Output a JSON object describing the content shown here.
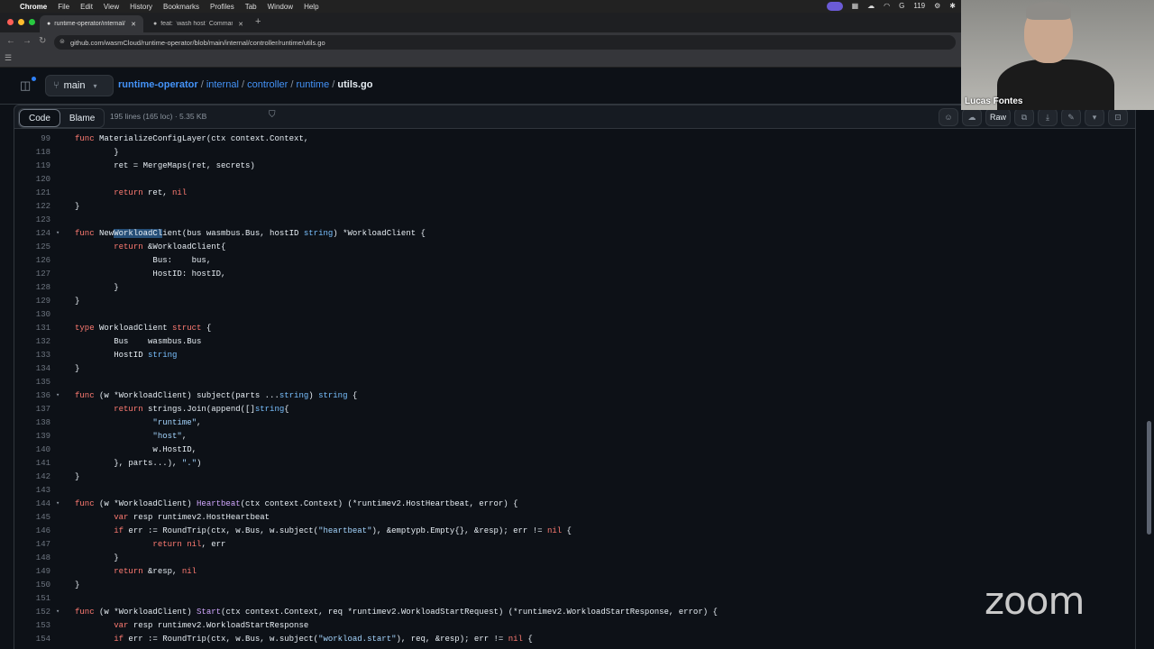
{
  "menubar": {
    "items": [
      "Chrome",
      "File",
      "Edit",
      "View",
      "History",
      "Bookmarks",
      "Profiles",
      "Tab",
      "Window",
      "Help"
    ],
    "status_count": "119"
  },
  "browser": {
    "tabs": [
      {
        "title": "runtime-operator/internal/co"
      },
      {
        "title": "feat: `wash host` Command"
      }
    ],
    "url": "github.com/wasmCloud/runtime-operator/blob/main/internal/controller/runtime/utils.go"
  },
  "repo": {
    "branch": "main",
    "breadcrumb": [
      "runtime-operator",
      "internal",
      "controller",
      "runtime"
    ],
    "filename": "utils.go",
    "sep": "/"
  },
  "filebar": {
    "code_label": "Code",
    "blame_label": "Blame",
    "info": "195 lines (165 loc) · 5.35 KB",
    "raw_label": "Raw"
  },
  "code_lines": [
    {
      "n": "99",
      "fold": false,
      "text": "func MaterializeConfigLayer(ctx context.Context,"
    },
    {
      "n": "118",
      "fold": false,
      "text": "        }"
    },
    {
      "n": "119",
      "fold": false,
      "text": "        ret = MergeMaps(ret, secrets)"
    },
    {
      "n": "120",
      "fold": false,
      "text": ""
    },
    {
      "n": "121",
      "fold": false,
      "text": "        return ret, nil"
    },
    {
      "n": "122",
      "fold": false,
      "text": "}"
    },
    {
      "n": "123",
      "fold": false,
      "text": ""
    },
    {
      "n": "124",
      "fold": true,
      "text": "func NewWorkloadClient(bus wasmbus.Bus, hostID string) *WorkloadClient {"
    },
    {
      "n": "125",
      "fold": false,
      "text": "        return &WorkloadClient{"
    },
    {
      "n": "126",
      "fold": false,
      "text": "                Bus:    bus,"
    },
    {
      "n": "127",
      "fold": false,
      "text": "                HostID: hostID,"
    },
    {
      "n": "128",
      "fold": false,
      "text": "        }"
    },
    {
      "n": "129",
      "fold": false,
      "text": "}"
    },
    {
      "n": "130",
      "fold": false,
      "text": ""
    },
    {
      "n": "131",
      "fold": false,
      "text": "type WorkloadClient struct {"
    },
    {
      "n": "132",
      "fold": false,
      "text": "        Bus    wasmbus.Bus"
    },
    {
      "n": "133",
      "fold": false,
      "text": "        HostID string"
    },
    {
      "n": "134",
      "fold": false,
      "text": "}"
    },
    {
      "n": "135",
      "fold": false,
      "text": ""
    },
    {
      "n": "136",
      "fold": true,
      "text": "func (w *WorkloadClient) subject(parts ...string) string {"
    },
    {
      "n": "137",
      "fold": false,
      "text": "        return strings.Join(append([]string{"
    },
    {
      "n": "138",
      "fold": false,
      "text": "                \"runtime\","
    },
    {
      "n": "139",
      "fold": false,
      "text": "                \"host\","
    },
    {
      "n": "140",
      "fold": false,
      "text": "                w.HostID,"
    },
    {
      "n": "141",
      "fold": false,
      "text": "        }, parts...), \".\")"
    },
    {
      "n": "142",
      "fold": false,
      "text": "}"
    },
    {
      "n": "143",
      "fold": false,
      "text": ""
    },
    {
      "n": "144",
      "fold": true,
      "text": "func (w *WorkloadClient) Heartbeat(ctx context.Context) (*runtimev2.HostHeartbeat, error) {"
    },
    {
      "n": "145",
      "fold": false,
      "text": "        var resp runtimev2.HostHeartbeat"
    },
    {
      "n": "146",
      "fold": false,
      "text": "        if err := RoundTrip(ctx, w.Bus, w.subject(\"heartbeat\"), &emptypb.Empty{}, &resp); err != nil {"
    },
    {
      "n": "147",
      "fold": false,
      "text": "                return nil, err"
    },
    {
      "n": "148",
      "fold": false,
      "text": "        }"
    },
    {
      "n": "149",
      "fold": false,
      "text": "        return &resp, nil"
    },
    {
      "n": "150",
      "fold": false,
      "text": "}"
    },
    {
      "n": "151",
      "fold": false,
      "text": ""
    },
    {
      "n": "152",
      "fold": true,
      "text": "func (w *WorkloadClient) Start(ctx context.Context, req *runtimev2.WorkloadStartRequest) (*runtimev2.WorkloadStartResponse, error) {"
    },
    {
      "n": "153",
      "fold": false,
      "text": "        var resp runtimev2.WorkloadStartResponse"
    },
    {
      "n": "154",
      "fold": false,
      "text": "        if err := RoundTrip(ctx, w.Bus, w.subject(\"workload.start\"), req, &resp); err != nil {"
    }
  ],
  "selection": {
    "line": "124",
    "text": "WorkloadCl"
  },
  "webcam": {
    "name": "Lucas Fontes"
  },
  "overlay": {
    "logo": "zoom"
  },
  "colors": {
    "keyword": "#ff7b72",
    "function": "#d2a8ff",
    "string": "#a5d6ff",
    "type": "#79c0ff",
    "link": "#4493f8",
    "selection": "#264f78"
  }
}
